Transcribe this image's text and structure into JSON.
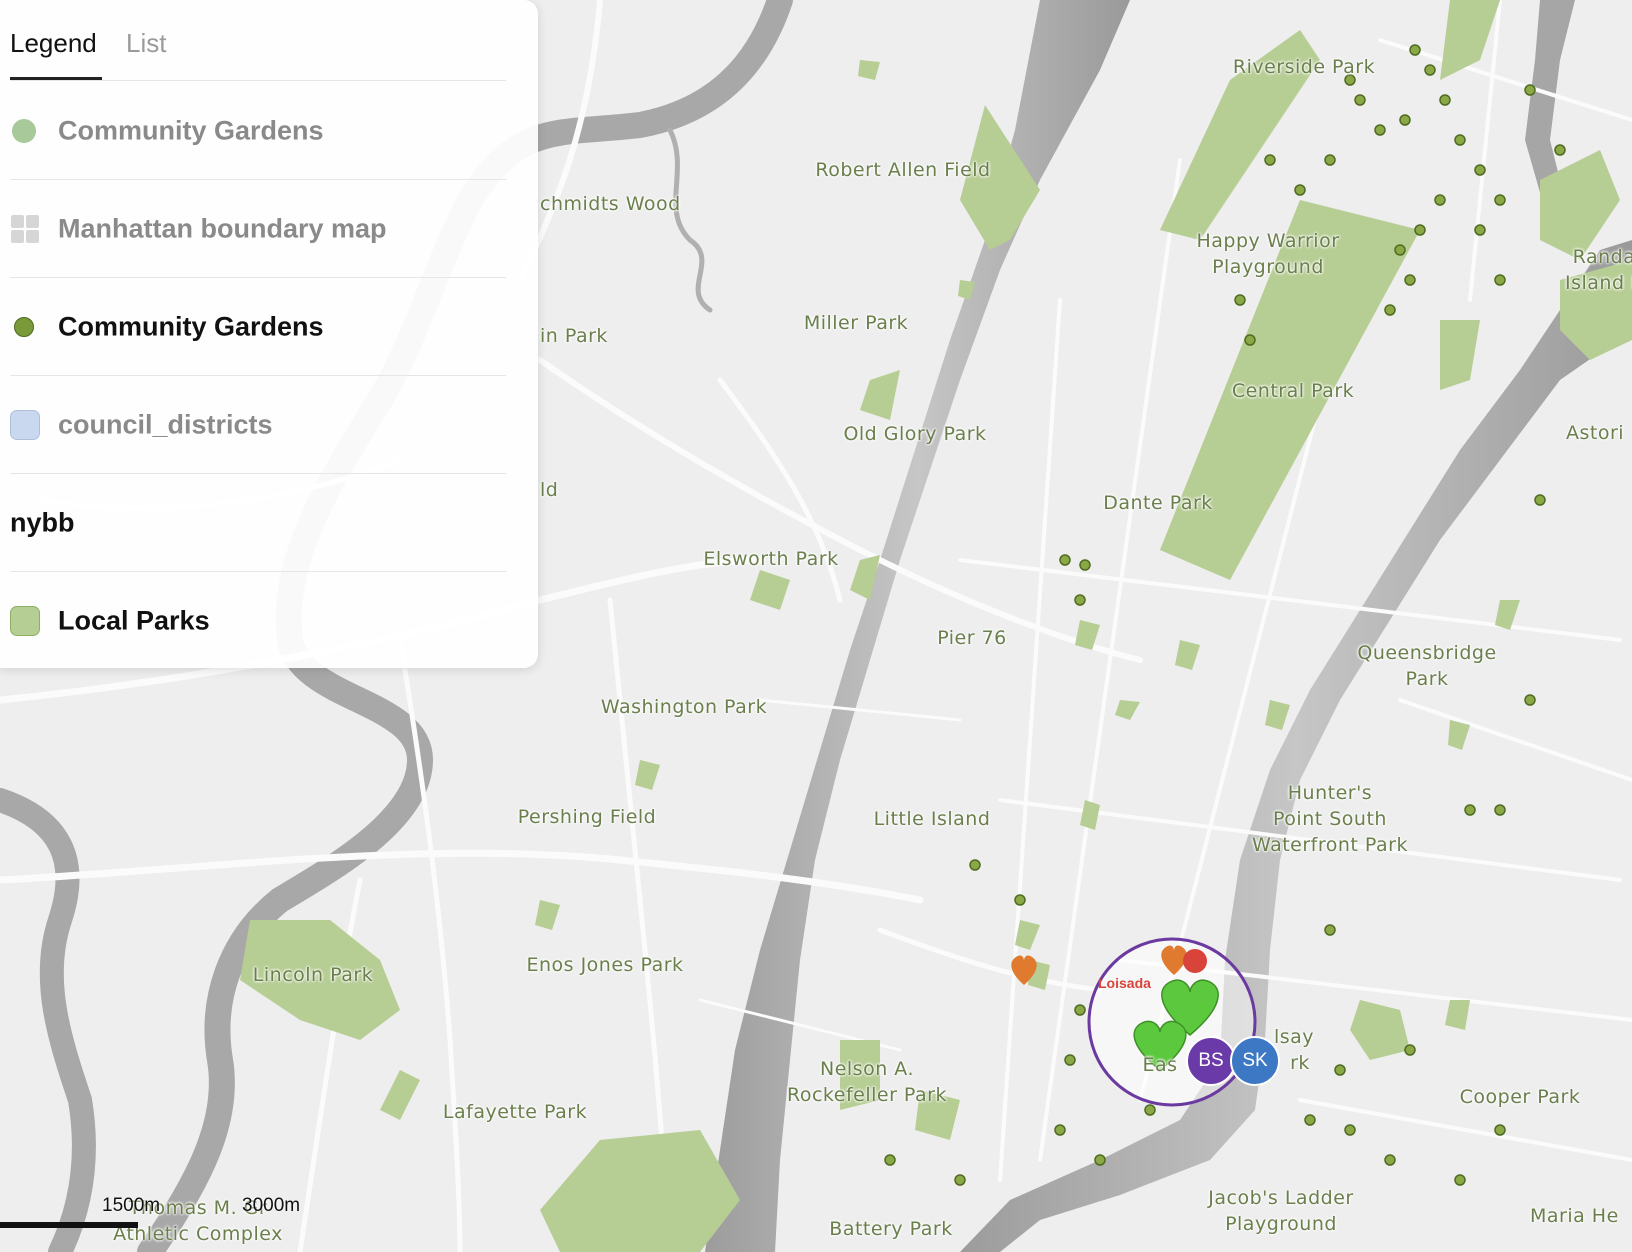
{
  "legend": {
    "tabs": [
      {
        "label": "Legend"
      },
      {
        "label": "List"
      }
    ],
    "layers": [
      {
        "label": "Community Gardens",
        "symbol": "dot-light",
        "color": "#a8c99a"
      },
      {
        "label": "Manhattan boundary map",
        "symbol": "tiles",
        "color": "#d6d6d6"
      },
      {
        "label": "Community Gardens",
        "symbol": "dot",
        "color": "#7a9a3a"
      },
      {
        "label": "council_districts",
        "symbol": "square",
        "color": "#c9d8ef"
      },
      {
        "label": "nybb",
        "symbol": "none"
      },
      {
        "label": "Local Parks",
        "symbol": "square",
        "color": "#b5ce93"
      }
    ]
  },
  "map": {
    "colors": {
      "land": "#eeeeee",
      "water": "#a3a3a3",
      "road": "#fbfbfb",
      "park": "#b6cd94",
      "garden_dot": "#7f9a3c",
      "label": "#6b7f4c"
    },
    "place_labels": [
      "Riverside Park",
      "Robert Allen Field",
      "chmidts Wood",
      "Happy Warrior\nPlayground",
      "Randa\nIsland P",
      "in Park",
      "Miller Park",
      "Central Park",
      "Astori",
      "Old Glory Park",
      "ld",
      "Dante Park",
      "Elsworth Park",
      "Pier 76",
      "Queensbridge\nPark",
      "Washington Park",
      "Hunter's\nPoint South\nWaterfront Park",
      "Pershing Field",
      "Little Island",
      "Enos Jones Park",
      "Lincoln Park",
      "Nelson A.\nRockefeller Park",
      "Cooper Park",
      "Lafayette Park",
      "Jacob's Ladder\nPlayground",
      "Battery Park",
      "Maria He",
      "Thomas M. Gr\nAthletic Complex",
      "lsay",
      "rk",
      "Eas"
    ],
    "scale": {
      "label_1": "1500m",
      "label_2": "3000m"
    },
    "cluster": {
      "label": "Loisada"
    },
    "users": [
      {
        "initials": "BS",
        "color": "#6a3aa8"
      },
      {
        "initials": "SK",
        "color": "#3c78c4"
      }
    ],
    "markers": {
      "heart_orange": "#e07a2f",
      "heart_green": "#5cc83d",
      "pin_red": "#d8433a",
      "cluster_ring": "#6b3aa0"
    }
  }
}
